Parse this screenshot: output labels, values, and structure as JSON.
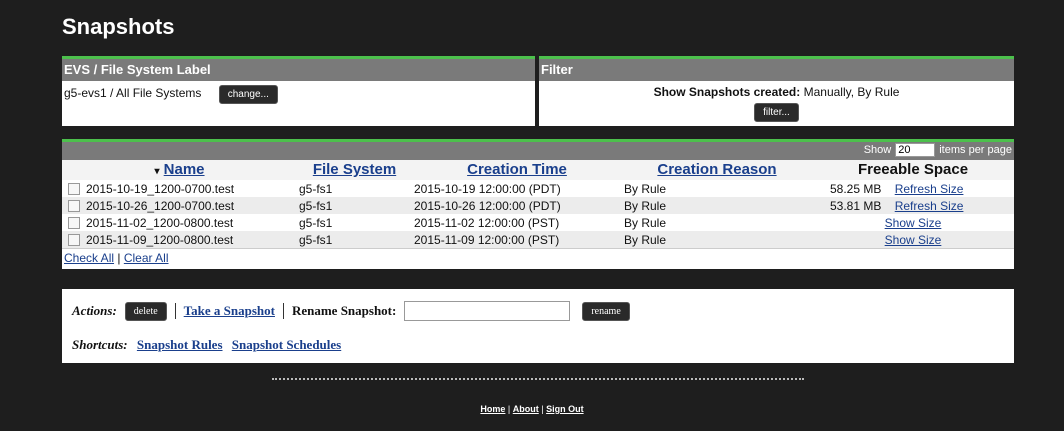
{
  "page": {
    "title": "Snapshots"
  },
  "evs": {
    "header": "EVS / File System Label",
    "label": "g5-evs1 /  All File Systems",
    "change_button": "change..."
  },
  "filter": {
    "header": "Filter",
    "prefix": "Show Snapshots created:",
    "value": "Manually, By Rule",
    "button": "filter..."
  },
  "pager": {
    "show": "Show",
    "value": "20",
    "suffix": "items per page"
  },
  "table": {
    "headers": {
      "sort_icon": "▾",
      "name": "Name",
      "file_system": "File System",
      "creation_time": "Creation Time",
      "creation_reason": "Creation Reason",
      "freeable": "Freeable Space"
    },
    "rows": [
      {
        "name": "2015-10-19_1200-0700.test",
        "fs": "g5-fs1",
        "time": "2015-10-19 12:00:00 (PDT)",
        "reason": "By Rule",
        "size": "58.25 MB",
        "link": "Refresh Size"
      },
      {
        "name": "2015-10-26_1200-0700.test",
        "fs": "g5-fs1",
        "time": "2015-10-26 12:00:00 (PDT)",
        "reason": "By Rule",
        "size": "53.81 MB",
        "link": "Refresh Size"
      },
      {
        "name": "2015-11-02_1200-0800.test",
        "fs": "g5-fs1",
        "time": "2015-11-02 12:00:00 (PST)",
        "reason": "By Rule",
        "size": "",
        "link": "Show Size"
      },
      {
        "name": "2015-11-09_1200-0800.test",
        "fs": "g5-fs1",
        "time": "2015-11-09 12:00:00 (PST)",
        "reason": "By Rule",
        "size": "",
        "link": "Show Size"
      }
    ],
    "check_all": "Check All",
    "clear_all": "Clear All"
  },
  "actions": {
    "label": "Actions:",
    "delete": "delete",
    "take_snapshot": "Take a Snapshot",
    "rename_label": "Rename Snapshot:",
    "rename_value": "",
    "rename_button": "rename"
  },
  "shortcuts": {
    "label": "Shortcuts:",
    "rules": "Snapshot Rules",
    "schedules": "Snapshot Schedules"
  },
  "footer": {
    "home": "Home",
    "about": "About",
    "signout": "Sign Out"
  }
}
